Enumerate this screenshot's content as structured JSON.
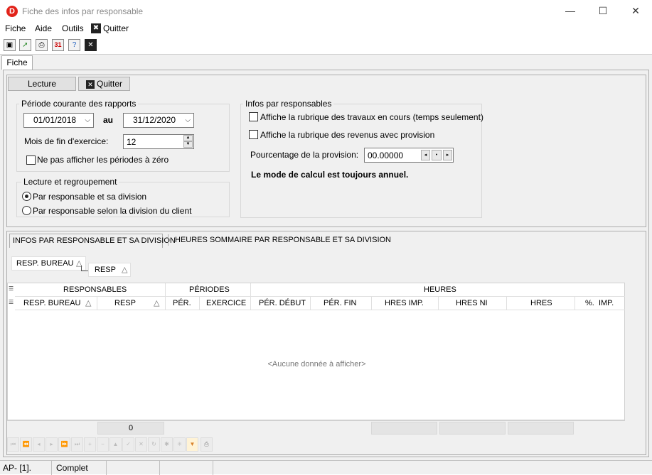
{
  "window": {
    "title": "Fiche des infos par responsable",
    "app_icon_letter": "D",
    "minimize": "—",
    "maximize": "☐",
    "close": "✕"
  },
  "menu": {
    "items": [
      "Fiche",
      "Aide",
      "Outils"
    ],
    "quit": "Quitter",
    "quit_icon": "✖"
  },
  "toolbar": {
    "icons": [
      "fit-window-icon",
      "export-icon",
      "print-icon",
      "calendar-icon",
      "help-icon",
      "close-icon"
    ],
    "calendar_text": "31"
  },
  "tab": {
    "label": "Fiche"
  },
  "buttons": {
    "lecture": "Lecture",
    "quitter": "Quitter"
  },
  "periode": {
    "title": "Période courante des rapports",
    "date_from": "01/01/2018",
    "au": "au",
    "date_to": "31/12/2020",
    "mois_label": "Mois de fin d'exercice:",
    "mois_value": "12",
    "zero_label": "Ne pas afficher les périodes à zéro"
  },
  "lecture": {
    "title": "Lecture et regroupement",
    "option1": "Par responsable et sa division",
    "option2": "Par responsable selon la division du client",
    "selected": 1
  },
  "infos": {
    "title": "Infos par responsables",
    "chk1": "Affiche la rubrique des travaux en cours (temps seulement)",
    "chk2": "Affiche la rubrique des revenus avec provision",
    "pct_label": "Pourcentage de la provision:",
    "pct_value": "00.00000",
    "note": "Le mode de calcul est toujours annuel."
  },
  "grid_tabs": {
    "tab1": "INFOS PAR RESPONSABLE ET SA DIVISION",
    "tab2": "HEURES SOMMAIRE PAR RESPONSABLE ET SA DIVISION"
  },
  "group_by": {
    "field1": "RESP. BUREAU",
    "field2": "RESP",
    "sort_glyph": "△"
  },
  "grid": {
    "band_headers": [
      "RESPONSABLES",
      "PÉRIODES",
      "HEURES"
    ],
    "columns": [
      "RESP. BUREAU",
      "RESP",
      "PÉR.",
      "EXERCICE",
      "PÉR. DÉBUT",
      "PÉR. FIN",
      "HRES IMP.",
      "HRES NI",
      "HRES",
      "%.  IMP."
    ],
    "empty_text": "<Aucune donnée à afficher>",
    "footer_count": "0"
  },
  "status": {
    "cell1": "AP- [1].",
    "cell2": "Complet"
  }
}
